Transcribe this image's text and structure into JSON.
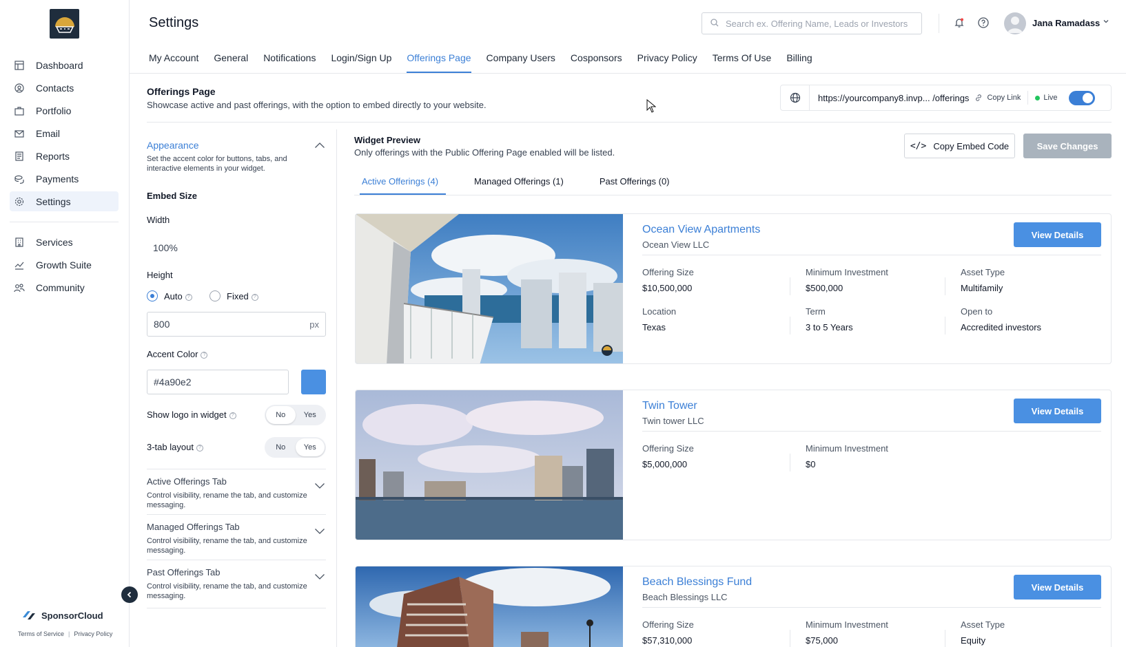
{
  "sidebar": {
    "items": [
      {
        "label": "Dashboard",
        "icon": "dashboard-icon"
      },
      {
        "label": "Contacts",
        "icon": "contacts-icon"
      },
      {
        "label": "Portfolio",
        "icon": "portfolio-icon"
      },
      {
        "label": "Email",
        "icon": "email-icon"
      },
      {
        "label": "Reports",
        "icon": "reports-icon"
      },
      {
        "label": "Payments",
        "icon": "payments-icon"
      },
      {
        "label": "Settings",
        "icon": "settings-icon"
      }
    ],
    "secondary_items": [
      {
        "label": "Services",
        "icon": "services-icon"
      },
      {
        "label": "Growth Suite",
        "icon": "growth-icon"
      },
      {
        "label": "Community",
        "icon": "community-icon"
      }
    ],
    "brand": "SponsorCloud",
    "footer_links": [
      "Terms of Service",
      "Privacy Policy"
    ]
  },
  "header": {
    "title": "Settings",
    "search_placeholder": "Search ex. Offering Name, Leads or Investors",
    "user_name": "Jana Ramadass"
  },
  "tabs": [
    "My Account",
    "General",
    "Notifications",
    "Login/Sign Up",
    "Offerings Page",
    "Company Users",
    "Cosponsors",
    "Privacy Policy",
    "Terms Of Use",
    "Billing"
  ],
  "active_tab": "Offerings Page",
  "section": {
    "title": "Offerings Page",
    "description": "Showcase active and past offerings, with the option to embed directly to your website.",
    "url": "https://yourcompany8.invp... /offerings",
    "copy_link": "Copy Link",
    "live_label": "Live"
  },
  "settings_panel": {
    "appearance_title": "Appearance",
    "appearance_desc": "Set the accent color for buttons, tabs, and interactive elements in your widget.",
    "embed_size": "Embed Size",
    "width_label": "Width",
    "width_value": "100%",
    "height_label": "Height",
    "height_auto": "Auto",
    "height_fixed": "Fixed",
    "height_value": "800",
    "height_unit": "px",
    "accent_label": "Accent Color",
    "accent_value": "#4a90e2",
    "show_logo_label": "Show logo in widget",
    "three_tab_label": "3-tab layout",
    "no": "No",
    "yes": "Yes",
    "accordions": [
      {
        "title": "Active Offerings Tab",
        "desc": "Control visibility, rename the tab, and customize messaging."
      },
      {
        "title": "Managed Offerings Tab",
        "desc": "Control visibility, rename the tab, and customize messaging."
      },
      {
        "title": "Past Offerings Tab",
        "desc": "Control visibility, rename the tab, and customize messaging."
      }
    ]
  },
  "preview": {
    "title": "Widget Preview",
    "desc": "Only offerings with the Public Offering Page enabled will be listed.",
    "copy_embed": "Copy Embed Code",
    "save": "Save Changes",
    "tabs": [
      "Active Offerings (4)",
      "Managed Offerings (1)",
      "Past Offerings (0)"
    ],
    "view_details": "View Details",
    "offerings": [
      {
        "name": "Ocean View Apartments",
        "company": "Ocean View LLC",
        "metrics": [
          {
            "k": "Offering Size",
            "v": "$10,500,000"
          },
          {
            "k": "Minimum Investment",
            "v": "$500,000"
          },
          {
            "k": "Asset Type",
            "v": "Multifamily"
          },
          {
            "k": "Location",
            "v": "Texas"
          },
          {
            "k": "Term",
            "v": "3 to 5 Years"
          },
          {
            "k": "Open to",
            "v": "Accredited investors"
          }
        ]
      },
      {
        "name": "Twin Tower",
        "company": "Twin tower LLC",
        "metrics": [
          {
            "k": "Offering Size",
            "v": "$5,000,000"
          },
          {
            "k": "Minimum Investment",
            "v": "$0"
          }
        ]
      },
      {
        "name": "Beach Blessings Fund",
        "company": "Beach Blessings LLC",
        "metrics": [
          {
            "k": "Offering Size",
            "v": "$57,310,000"
          },
          {
            "k": "Minimum Investment",
            "v": "$75,000"
          },
          {
            "k": "Asset Type",
            "v": "Equity"
          }
        ]
      }
    ]
  },
  "colors": {
    "accent": "#4a90e2",
    "live": "#22c55e",
    "brand_dark": "#1f2d3d"
  }
}
